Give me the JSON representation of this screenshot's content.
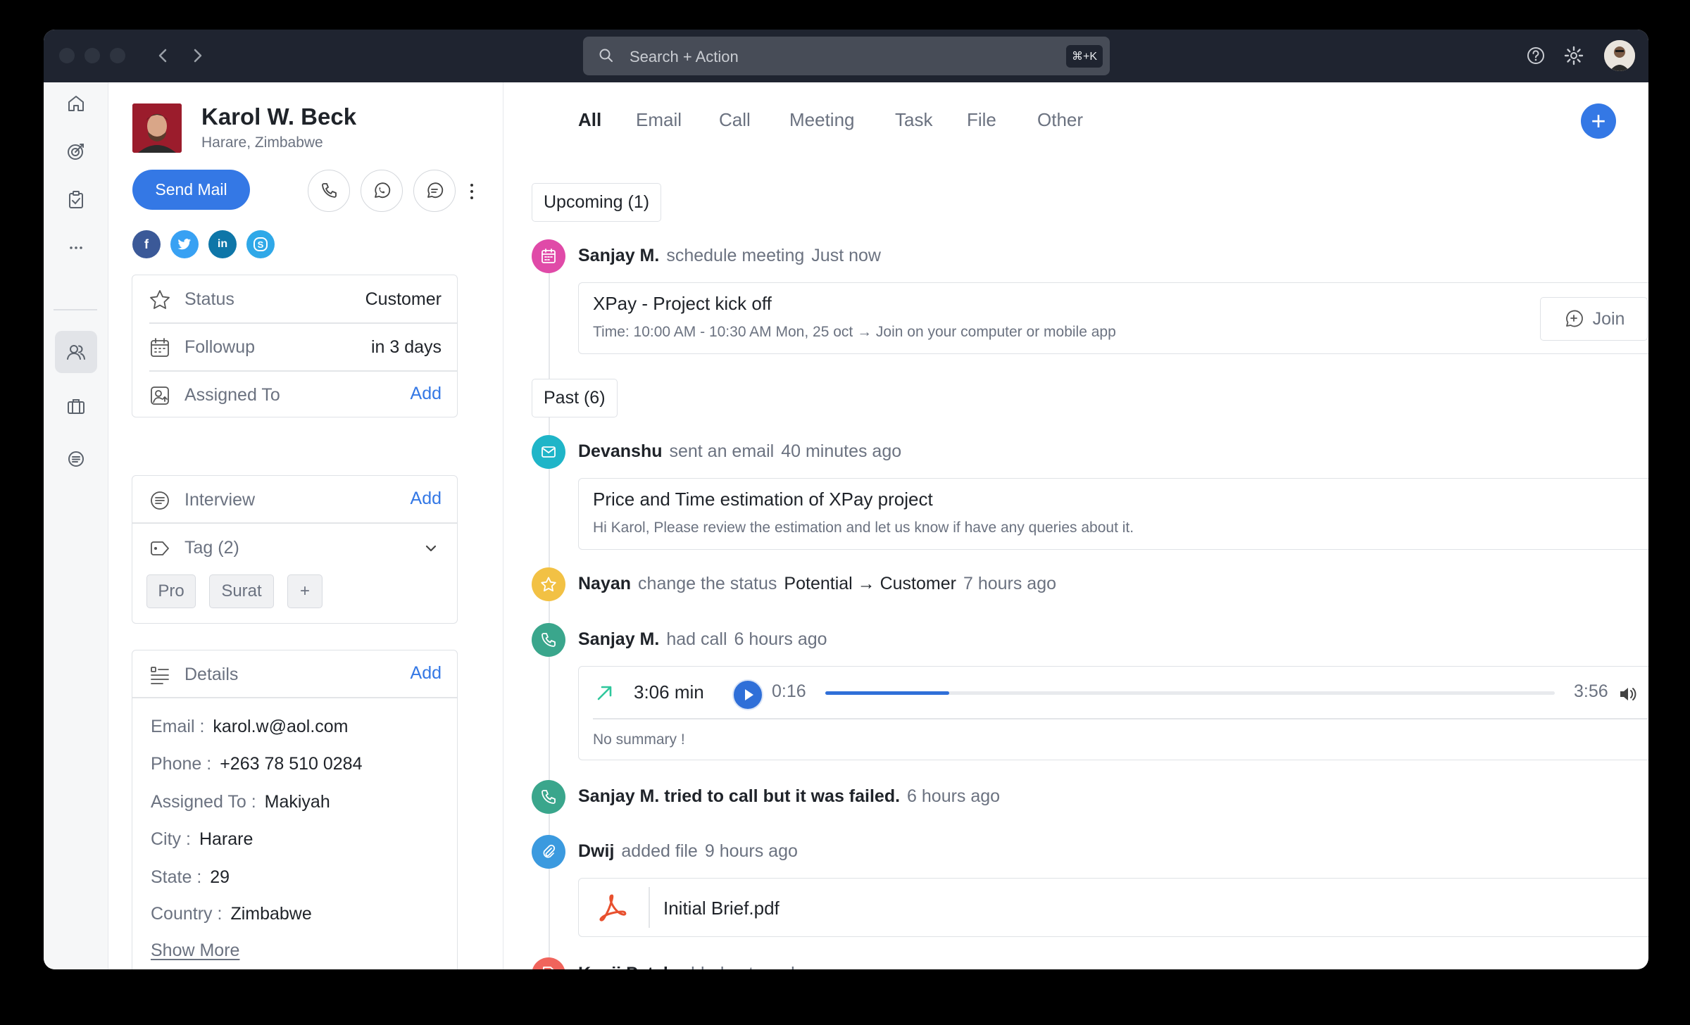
{
  "app": {
    "search_placeholder": "Search + Action",
    "search_shortcut": "⌘+K"
  },
  "contact": {
    "name": "Karol W. Beck",
    "location": "Harare, Zimbabwe",
    "send_mail_label": "Send Mail",
    "social": [
      "facebook-icon",
      "twitter-icon",
      "linkedin-icon",
      "skype-icon"
    ]
  },
  "info_card": {
    "status_label": "Status",
    "status_value": "Customer",
    "followup_label": "Followup",
    "followup_value": "in 3 days",
    "assigned_label": "Assigned To",
    "assigned_action": "Add"
  },
  "interview_card": {
    "interview_label": "Interview",
    "interview_action": "Add",
    "tag_label": "Tag (2)",
    "tags": [
      "Pro",
      "Surat"
    ],
    "add_tag_label": "+"
  },
  "details_card": {
    "title": "Details",
    "action": "Add",
    "email_key": "Email :",
    "email_value": "karol.w@aol.com",
    "phone_key": "Phone :",
    "phone_value": "+263 78 510 0284",
    "assigned_key": "Assigned To :",
    "assigned_value": "Makiyah",
    "city_key": "City :",
    "city_value": "Harare",
    "state_key": "State :",
    "state_value": "29",
    "country_key": "Country :",
    "country_value": "Zimbabwe",
    "show_more": "Show More"
  },
  "tabs": [
    "All",
    "Email",
    "Call",
    "Meeting",
    "Task",
    "File",
    "Other"
  ],
  "timeline": {
    "upcoming_label": "Upcoming (1)",
    "past_label": "Past (6)",
    "meeting": {
      "who": "Sanjay M.",
      "action": "schedule meeting",
      "time": "Just now",
      "title": "XPay - Project kick off",
      "subtitle": "Time: 10:00 AM - 10:30 AM Mon, 25 oct → Join on your computer or mobile app",
      "join_label": "Join"
    },
    "email": {
      "who": "Devanshu",
      "action": "sent an email",
      "time": "40 minutes ago",
      "title": "Price and Time estimation of XPay project",
      "subtitle": "Hi Karol, Please review the estimation and let us know if have any queries about it."
    },
    "status": {
      "who": "Nayan",
      "action": "change the status",
      "change": "Potential → Customer",
      "time": "7 hours ago"
    },
    "call": {
      "who": "Sanjay M.",
      "action": "had call",
      "time": "6 hours ago",
      "duration": "3:06 min",
      "position": "0:16",
      "total": "3:56",
      "progress_fraction": 0.17,
      "summary": "No summary !"
    },
    "failed_call": {
      "who": "Sanjay M. tried to call but it was failed.",
      "time": "6 hours ago"
    },
    "file": {
      "who": "Dwij",
      "action": "added file",
      "time": "9 hours ago",
      "filename": "Initial Brief.pdf"
    },
    "note": {
      "who": "Kanji Patel",
      "action": "added note",
      "time": "a day ago",
      "more": "···"
    }
  },
  "colors": {
    "accent": "#3478e5",
    "meeting": "#e04aa8",
    "email": "#1fb5c8",
    "status": "#f2c144",
    "call": "#3aa68c",
    "file": "#3b9adf",
    "note": "#f0645c"
  }
}
